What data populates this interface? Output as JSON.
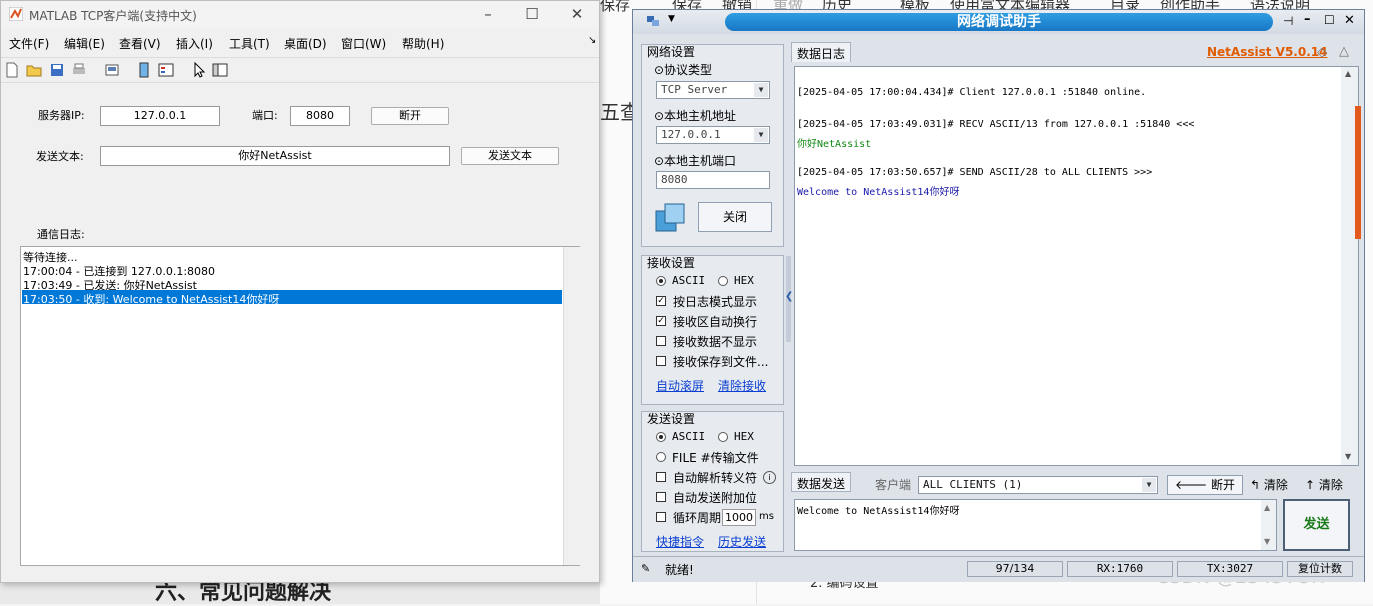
{
  "background": {
    "top_menu": [
      "保存",
      "撤销",
      "重做",
      "历史",
      "模板",
      "使用富文本编辑器",
      "目录",
      "创作助手",
      "语法说明"
    ],
    "left_fragment": "五查?",
    "bottom_fragment": "六、常见问题解决",
    "bottom_item": "2. 编码设置",
    "watermark": "CSDN @2345VOR"
  },
  "matlab": {
    "title": "MATLAB TCP客户端(支持中文)",
    "menu": [
      "文件(F)",
      "编辑(E)",
      "查看(V)",
      "插入(I)",
      "工具(T)",
      "桌面(D)",
      "窗口(W)",
      "帮助(H)"
    ],
    "server_ip_label": "服务器IP:",
    "server_ip_value": "127.0.0.1",
    "port_label": "端口:",
    "port_value": "8080",
    "disconnect_label": "断开",
    "send_text_label": "发送文本:",
    "send_text_value": "你好NetAssist",
    "send_button": "发送文本",
    "log_label": "通信日志:",
    "log": [
      "等待连接...",
      "17:00:04 - 已连接到 127.0.0.1:8080",
      "17:03:49 - 已发送: 你好NetAssist",
      "17:03:50 - 收到: Welcome to NetAssist14你好呀"
    ],
    "colors": {
      "selection": "#0078d7"
    }
  },
  "netassist": {
    "title": "网络调试助手",
    "version": "NetAssist V5.0.14",
    "net_settings": {
      "title": "网络设置",
      "protocol_label": "⊙协议类型",
      "protocol_value": "TCP Server",
      "host_label": "⊙本地主机地址",
      "host_value": "127.0.0.1",
      "port_label": "⊙本地主机端口",
      "port_value": "8080",
      "close_button": "关闭"
    },
    "recv_settings": {
      "title": "接收设置",
      "ascii": "ASCII",
      "hex": "HEX",
      "options": [
        "按日志模式显示",
        "接收区自动换行",
        "接收数据不显示",
        "接收保存到文件..."
      ],
      "checked": [
        true,
        true,
        false,
        false
      ],
      "link_auto": "自动滚屏",
      "link_clear": "清除接收"
    },
    "send_settings": {
      "title": "发送设置",
      "ascii": "ASCII",
      "hex": "HEX",
      "file_option": "FILE #传输文件",
      "options": [
        "自动解析转义符",
        "自动发送附加位"
      ],
      "cycle_label": "循环周期",
      "cycle_value": "1000",
      "cycle_unit": "ms",
      "link_quick": "快捷指令",
      "link_history": "历史发送"
    },
    "log_tab": "数据日志",
    "recv_lines": [
      {
        "text": "[2025-04-05 17:00:04.434]# Client 127.0.0.1 :51840 online.",
        "color": "#333333"
      },
      {
        "text": "[2025-04-05 17:03:49.031]# RECV ASCII/13 from 127.0.0.1 :51840 <<<",
        "color": "#333333"
      },
      {
        "text": "你好NetAssist",
        "color": "#118811"
      },
      {
        "text": "[2025-04-05 17:03:50.657]# SEND ASCII/28 to ALL CLIENTS >>>",
        "color": "#333333"
      },
      {
        "text": "Welcome to NetAssist14你好呀",
        "color": "#1a1aaa"
      }
    ],
    "send_tab": "数据发送",
    "client_label": "客户端",
    "client_value": "ALL CLIENTS (1)",
    "btn_disconnect": "断开",
    "btn_clear1": "清除",
    "btn_clear2": "清除",
    "send_content": "Welcome to NetAssist14你好呀",
    "send_button": "发送",
    "status": {
      "ready": "就绪!",
      "count": "97/134",
      "rx": "RX:1760",
      "tx": "TX:3027",
      "reset": "复位计数"
    },
    "colors": {
      "title_blue": "#1f86d3",
      "version_orange": "#e05a00"
    }
  }
}
